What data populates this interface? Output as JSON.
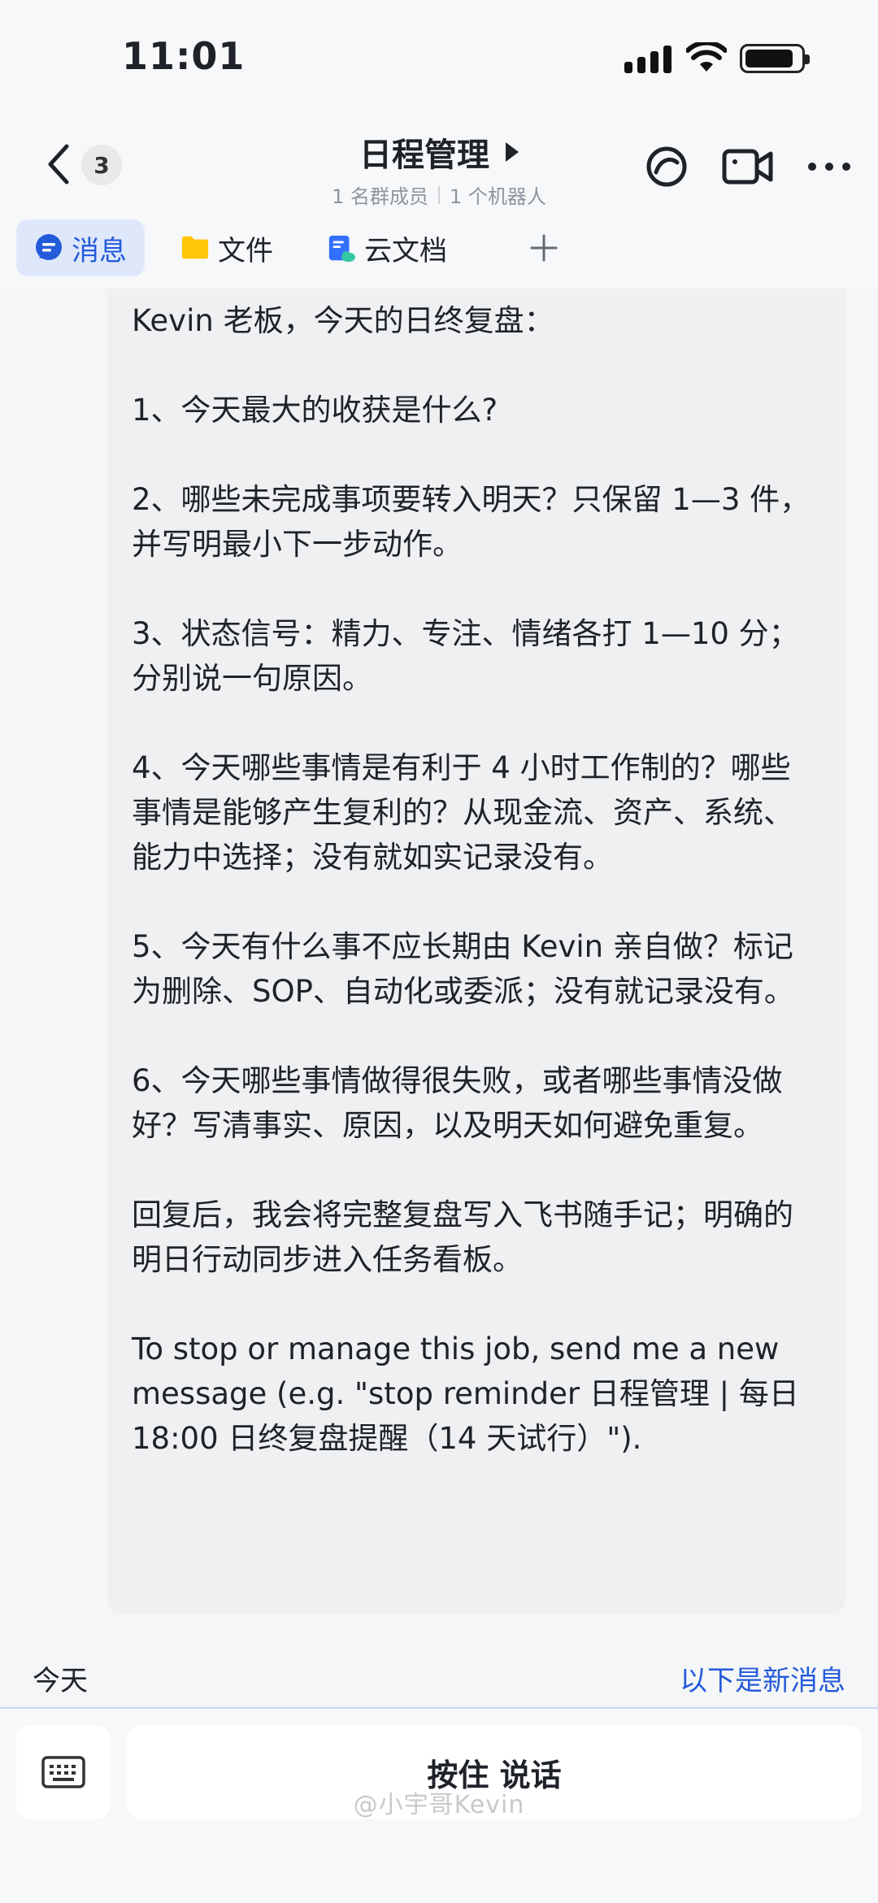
{
  "status_bar": {
    "time": "11:01"
  },
  "header": {
    "unread_count": "3",
    "title": "日程管理",
    "members": "1 名群成员",
    "bots": "1 个机器人"
  },
  "tabs": [
    {
      "label": "消息",
      "icon": "message-icon",
      "active": true
    },
    {
      "label": "文件",
      "icon": "folder-icon",
      "active": false
    },
    {
      "label": "云文档",
      "icon": "cloud-doc-icon",
      "active": false
    }
  ],
  "message": {
    "text": "Kevin 老板，今天的日终复盘：\n\n1、今天最大的收获是什么?\n\n2、哪些未完成事项要转入明天？只保留 1—3 件，并写明最小下一步动作。\n\n3、状态信号：精力、专注、情绪各打 1—10 分；分别说一句原因。\n\n4、今天哪些事情是有利于 4 小时工作制的？哪些事情是能够产生复利的？从现金流、资产、系统、能力中选择；没有就如实记录没有。\n\n5、今天有什么事不应长期由 Kevin 亲自做？标记为删除、SOP、自动化或委派；没有就记录没有。\n\n6、今天哪些事情做得很失败，或者哪些事情没做好？写清事实、原因，以及明天如何避免重复。\n\n回复后，我会将完整复盘写入飞书随手记；明确的明日行动同步进入任务看板。\n\nTo stop or manage this job, send me a new message (e.g. \"stop reminder 日程管理 | 每日 18:00 日终复盘提醒（14 天试行）\")."
  },
  "divider": {
    "date": "今天",
    "new_messages": "以下是新消息"
  },
  "input": {
    "talk_label": "按住 说话"
  },
  "watermark": "@小宇哥Kevin",
  "colors": {
    "accent": "#245bdb",
    "active_tab_bg": "#dfe8fb",
    "bubble_bg": "#eff0f1"
  }
}
